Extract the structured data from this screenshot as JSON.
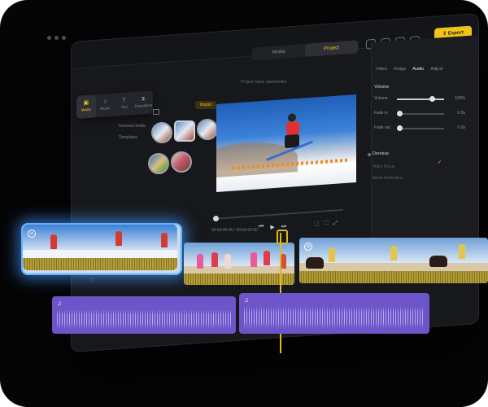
{
  "tabs": [
    "Media",
    "Project"
  ],
  "active_tab": "Project",
  "export_label": "Export",
  "side_nav": [
    {
      "label": "Media",
      "icon": "folder-icon",
      "active": true
    },
    {
      "label": "Music",
      "icon": "music-note-icon",
      "active": false
    },
    {
      "label": "Text",
      "icon": "text-icon",
      "active": false
    },
    {
      "label": "Transitions",
      "icon": "transition-icon",
      "active": false
    }
  ],
  "import_label": "Import",
  "media_categories": [
    "General media",
    "Templates"
  ],
  "project_name": "Project name placeholder",
  "timecode": "00:00:00:00 / 00:00:00:00",
  "right_tabs": [
    "Video",
    "Image",
    "Audio",
    "Adjust"
  ],
  "active_right_tab": "Audio",
  "volume": {
    "title": "Volume",
    "rows": [
      {
        "label": "Volume",
        "value": "100%",
        "level": 1.0
      },
      {
        "label": "Fade in",
        "value": "0.0s",
        "level": 0.0
      },
      {
        "label": "Fade out",
        "value": "0.0s",
        "level": 0.0
      }
    ]
  },
  "denoise": {
    "title": "Denoise",
    "enabled": true,
    "options": [
      "Voice Focus",
      "Noise Reduction"
    ]
  },
  "colors": {
    "accent": "#f0c419",
    "glow": "#5fb4ff",
    "audio": "#6c55c8"
  }
}
